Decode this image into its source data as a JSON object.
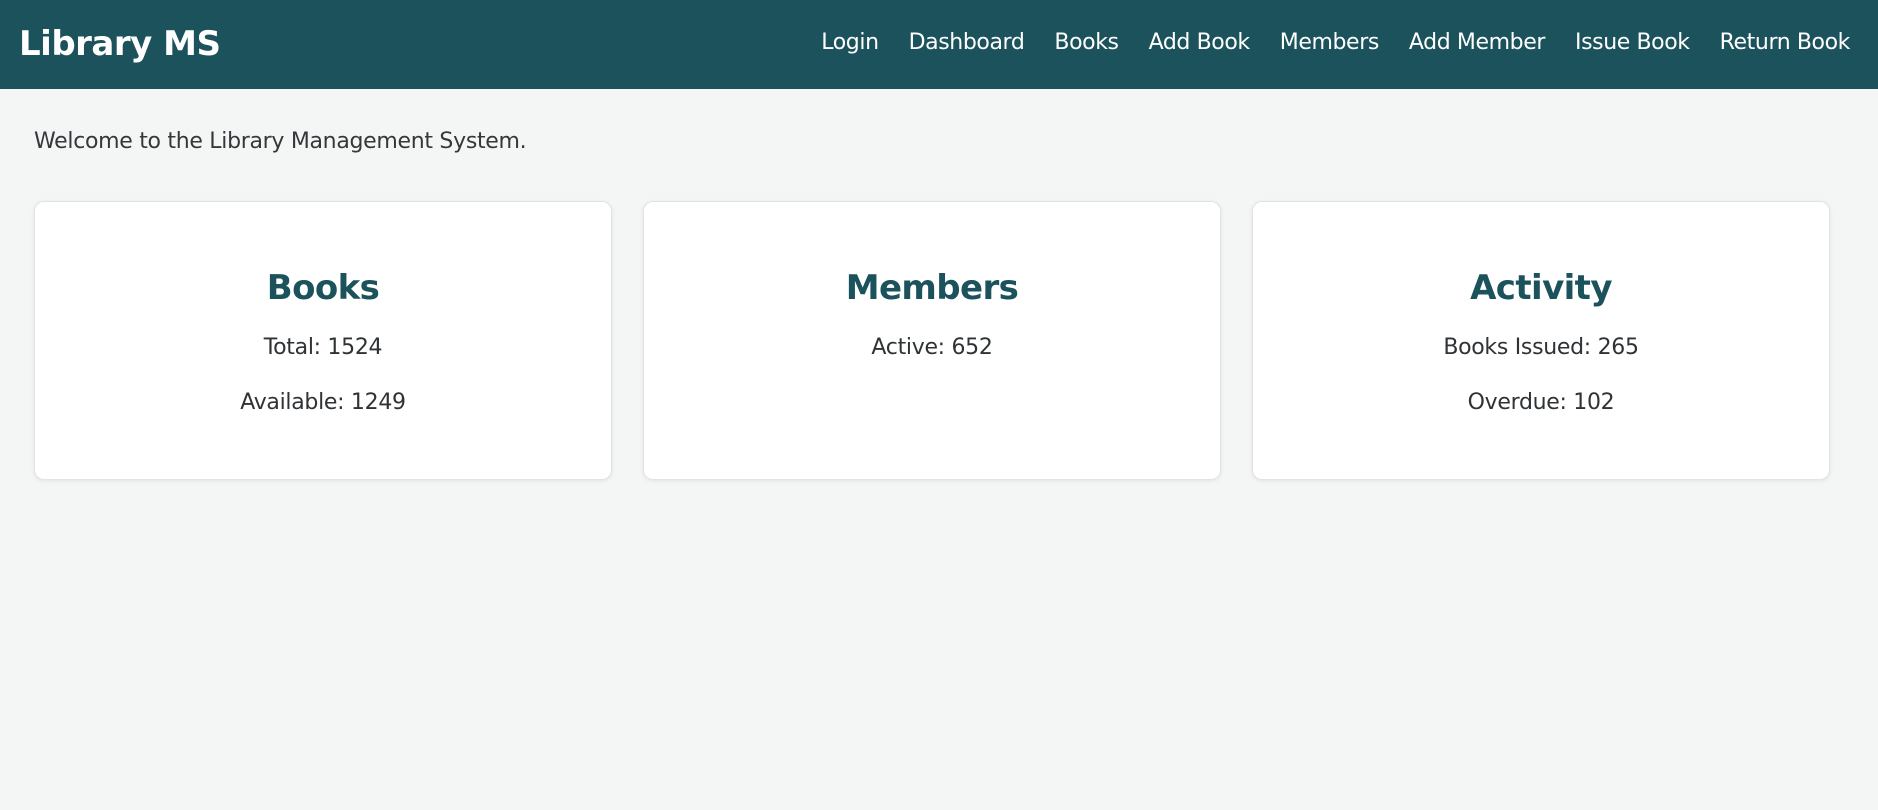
{
  "navbar": {
    "brand": "Library MS",
    "links": [
      "Login",
      "Dashboard",
      "Books",
      "Add Book",
      "Members",
      "Add Member",
      "Issue Book",
      "Return Book"
    ]
  },
  "main": {
    "welcome_text": "Welcome to the Library Management System.",
    "cards": [
      {
        "title": "Books",
        "stats": [
          "Total: 1524",
          "Available: 1249"
        ]
      },
      {
        "title": "Members",
        "stats": [
          "Active: 652"
        ]
      },
      {
        "title": "Activity",
        "stats": [
          "Books Issued: 265",
          "Overdue: 102"
        ]
      }
    ]
  },
  "colors": {
    "navbar_bg": "#1b525c",
    "page_bg": "#f4f6f5",
    "card_title": "#1b525c",
    "text": "#2f3336"
  }
}
